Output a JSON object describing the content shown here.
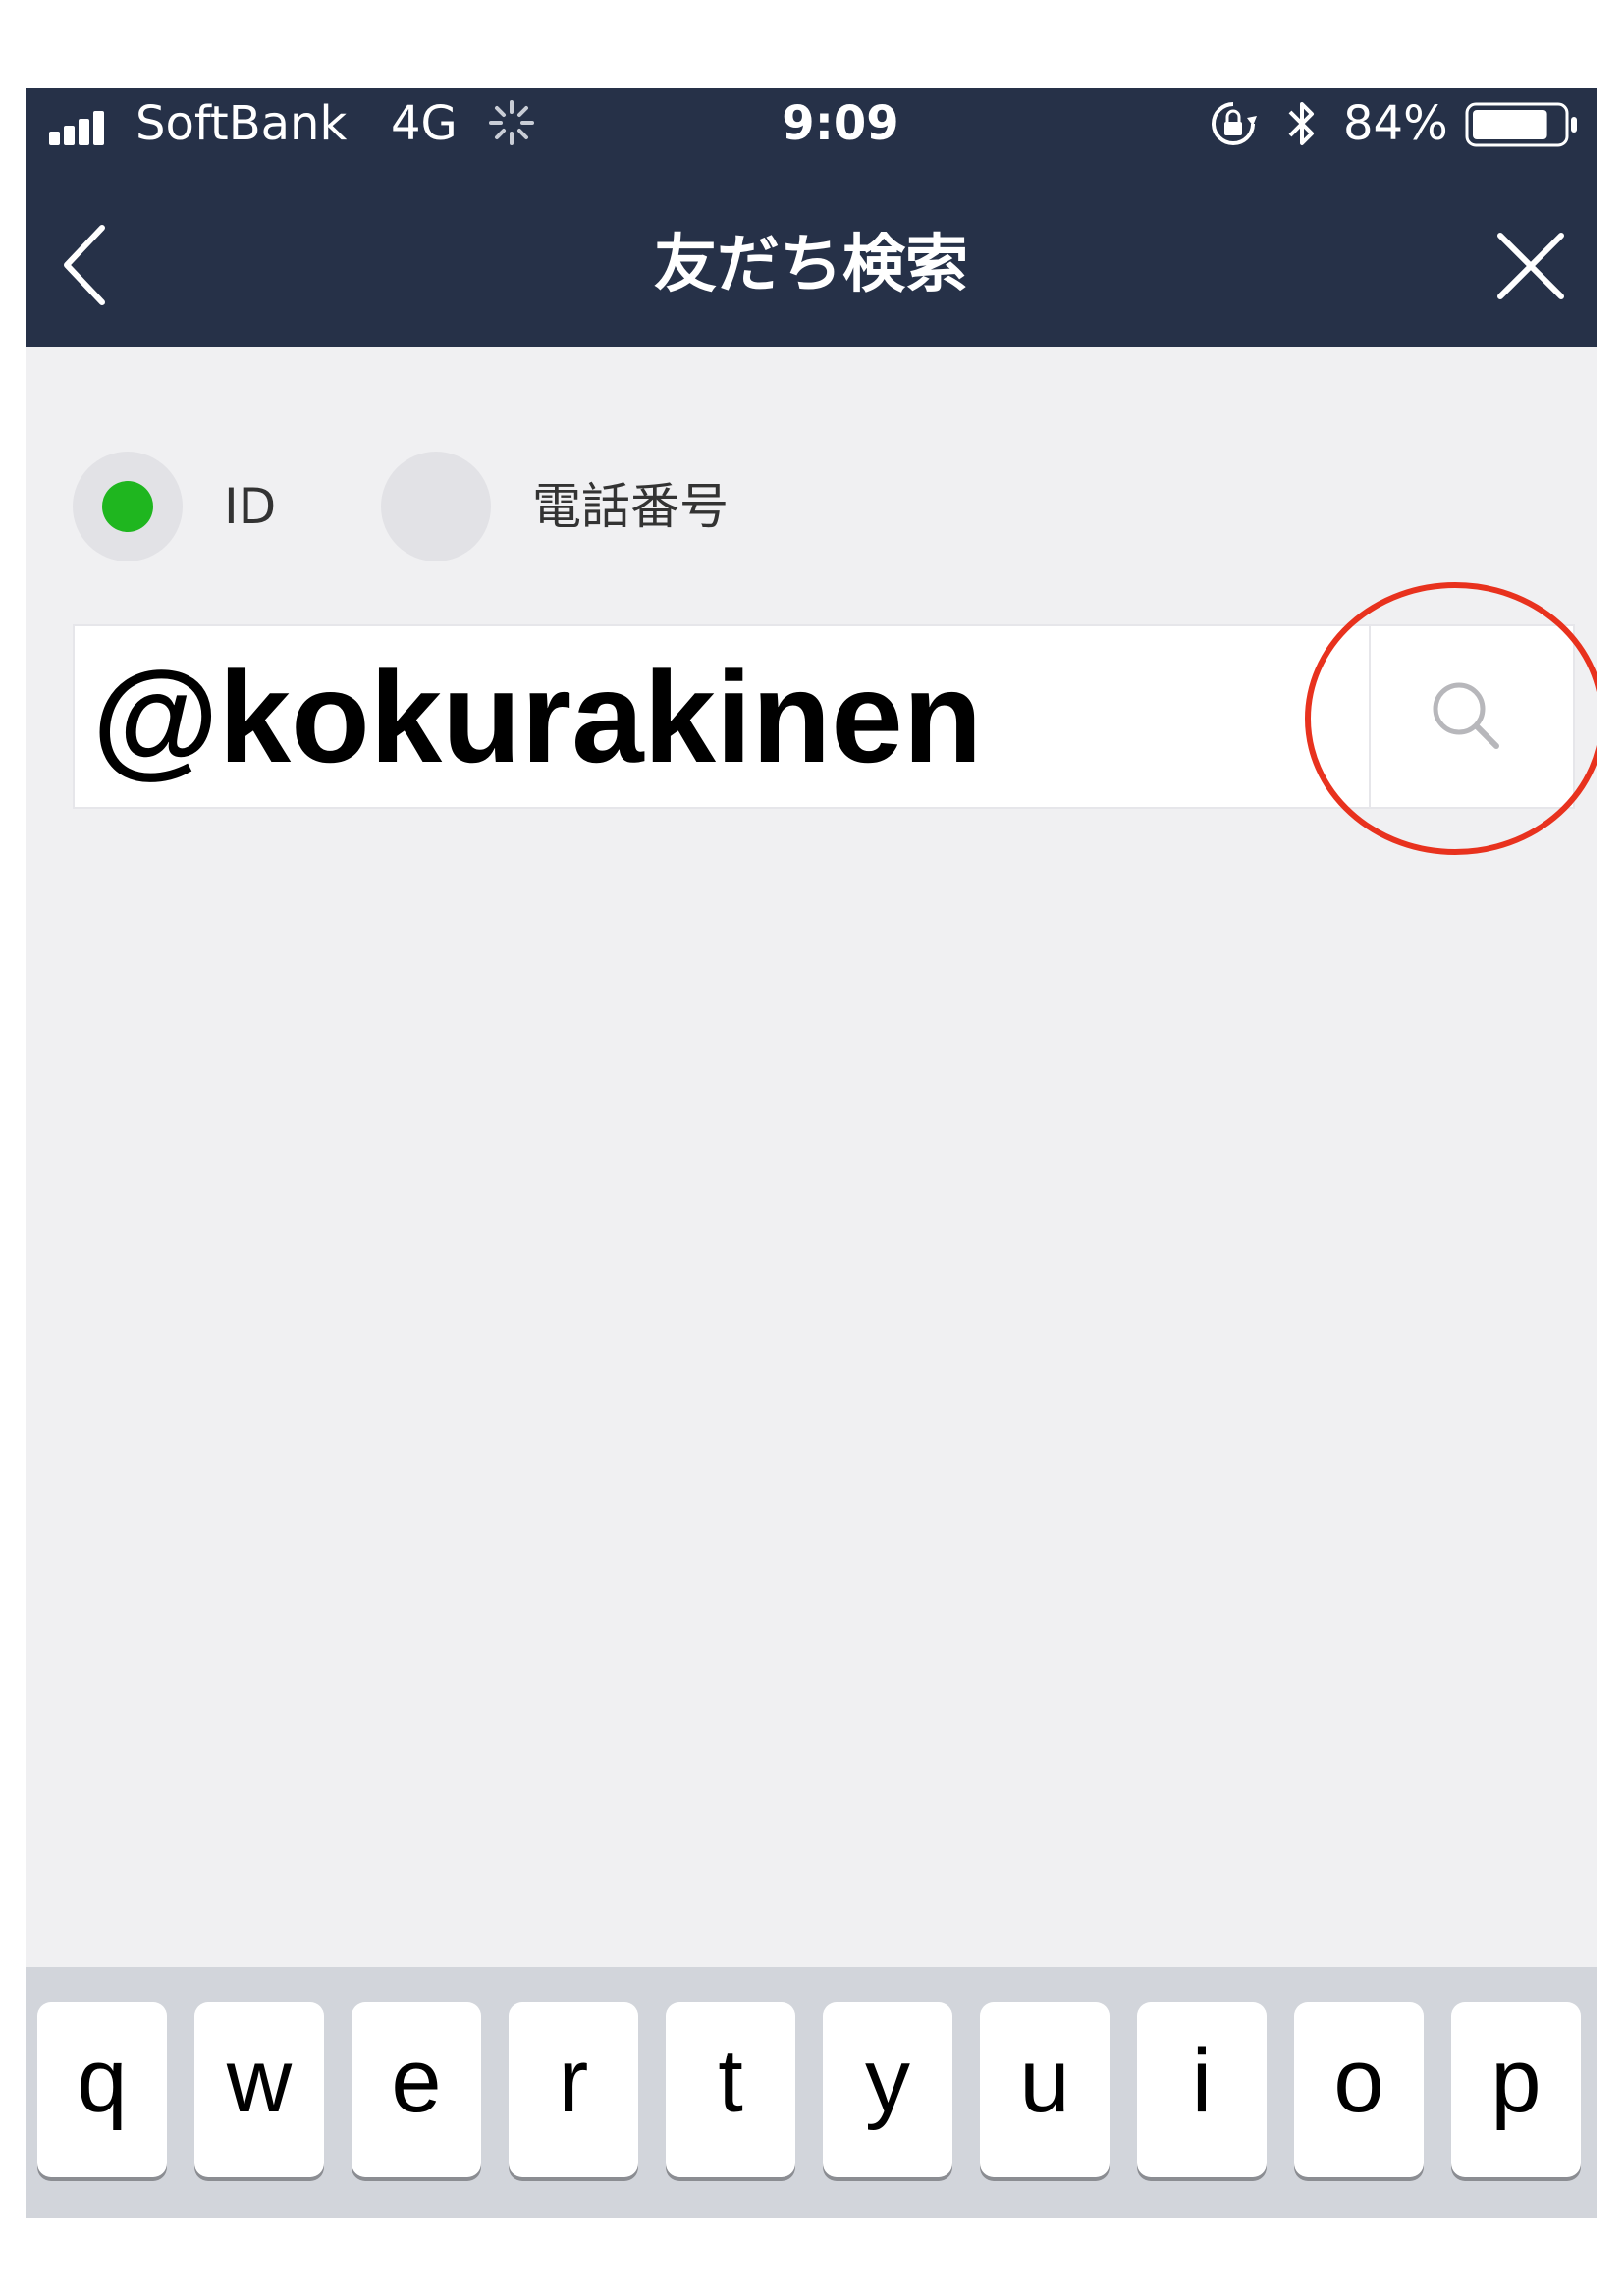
{
  "status_bar": {
    "carrier": "SoftBank",
    "network": "4G",
    "time": "9:09",
    "battery_percent": "84%",
    "battery_level": 0.84
  },
  "nav": {
    "title": "友だち検索"
  },
  "search_type": {
    "options": [
      {
        "label": "ID",
        "selected": true
      },
      {
        "label": "電話番号",
        "selected": false
      }
    ]
  },
  "search": {
    "value": "@kokurakinen"
  },
  "keyboard": {
    "row1": [
      "q",
      "w",
      "e",
      "r",
      "t",
      "y",
      "u",
      "i",
      "o",
      "p"
    ]
  },
  "colors": {
    "header_bg": "#263148",
    "radio_selected": "#1fb61f",
    "highlight_ring": "#e8321e"
  }
}
